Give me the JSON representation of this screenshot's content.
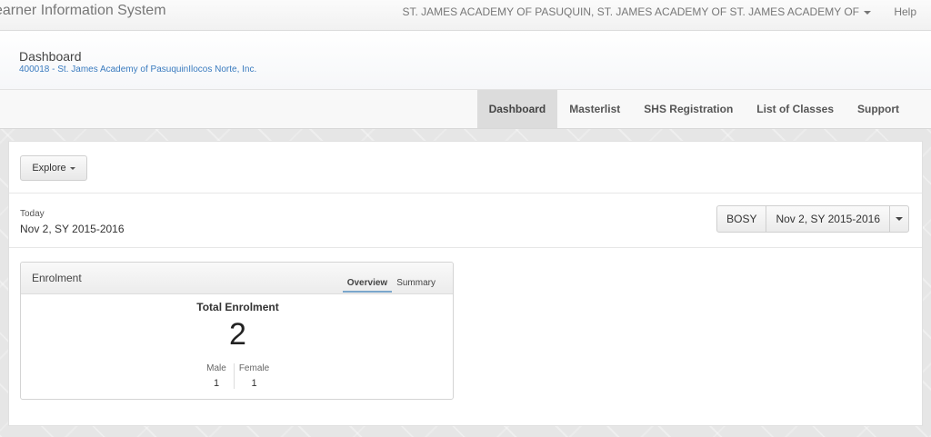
{
  "topbar": {
    "brand": "earner Information System",
    "school_menu": "ST. JAMES ACADEMY OF PASUQUIN, ST. JAMES ACADEMY OF ST. JAMES ACADEMY OF",
    "help": "Help"
  },
  "header": {
    "title": "Dashboard",
    "school_id_line": "400018 - St. James Academy of PasuquinIlocos Norte, Inc."
  },
  "tabs": [
    {
      "label": "Dashboard",
      "active": true
    },
    {
      "label": "Masterlist",
      "active": false
    },
    {
      "label": "SHS Registration",
      "active": false
    },
    {
      "label": "List of Classes",
      "active": false
    },
    {
      "label": "Support",
      "active": false
    }
  ],
  "toolbar": {
    "explore_label": "Explore"
  },
  "date": {
    "today_label": "Today",
    "today_value": "Nov 2, SY 2015-2016",
    "period_button": "BOSY",
    "date_button": "Nov 2, SY 2015-2016"
  },
  "enrolment": {
    "title": "Enrolment",
    "tabs": [
      {
        "label": "Overview",
        "active": true
      },
      {
        "label": "Summary",
        "active": false
      }
    ],
    "total_label": "Total Enrolment",
    "total_value": "2",
    "male_label": "Male",
    "male_value": "1",
    "female_label": "Female",
    "female_value": "1"
  },
  "colors": {
    "link": "#3a7bbf",
    "active_tab_bg": "#dcdcdc",
    "tab_underline": "#7aa6cc"
  }
}
